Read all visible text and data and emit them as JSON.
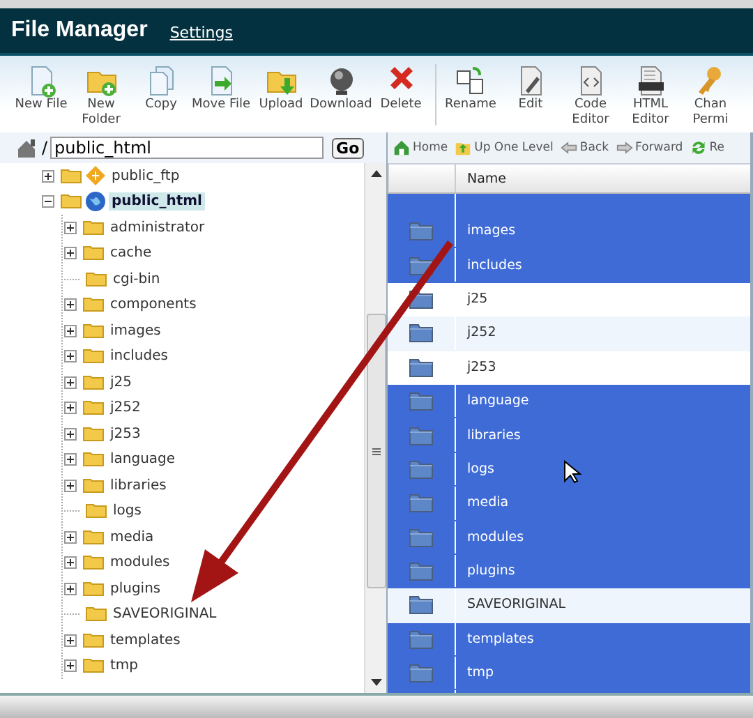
{
  "header": {
    "title": "File Manager",
    "link": "Settings"
  },
  "toolbar": [
    {
      "kind": "new-file",
      "label": "New File"
    },
    {
      "kind": "new-folder",
      "label": "New\nFolder"
    },
    {
      "kind": "copy",
      "label": "Copy"
    },
    {
      "kind": "move",
      "label": "Move File"
    },
    {
      "kind": "upload",
      "label": "Upload"
    },
    {
      "kind": "download",
      "label": "Download"
    },
    {
      "kind": "delete",
      "label": "Delete"
    },
    {
      "kind": "separator"
    },
    {
      "kind": "rename",
      "label": "Rename"
    },
    {
      "kind": "edit",
      "label": "Edit"
    },
    {
      "kind": "code",
      "label": "Code\nEditor"
    },
    {
      "kind": "html",
      "label": "HTML\nEditor"
    },
    {
      "kind": "keys",
      "label": "Chan\nPermi"
    }
  ],
  "path": {
    "prefix": "/",
    "value": "public_html",
    "button": "Go"
  },
  "tree": [
    {
      "label": "public_ftp",
      "kind": "ftp",
      "expanded": false,
      "selected": false
    },
    {
      "label": "public_html",
      "kind": "web",
      "expanded": true,
      "selected": true,
      "children": [
        {
          "label": "administrator",
          "expanded": false,
          "selected": false
        },
        {
          "label": "cache",
          "expanded": false,
          "selected": false
        },
        {
          "label": "cgi-bin",
          "selected": false
        },
        {
          "label": "components",
          "expanded": false,
          "selected": false
        },
        {
          "label": "images",
          "expanded": false,
          "selected": false
        },
        {
          "label": "includes",
          "expanded": false,
          "selected": false
        },
        {
          "label": "j25",
          "expanded": false,
          "selected": false
        },
        {
          "label": "j252",
          "expanded": false,
          "selected": false
        },
        {
          "label": "j253",
          "expanded": false,
          "selected": false
        },
        {
          "label": "language",
          "expanded": false,
          "selected": false
        },
        {
          "label": "libraries",
          "expanded": false,
          "selected": false
        },
        {
          "label": "logs",
          "selected": false
        },
        {
          "label": "media",
          "expanded": false,
          "selected": false
        },
        {
          "label": "modules",
          "expanded": false,
          "selected": false
        },
        {
          "label": "plugins",
          "expanded": false,
          "selected": false
        },
        {
          "label": "SAVEORIGINAL",
          "selected": false
        },
        {
          "label": "templates",
          "expanded": false,
          "selected": false
        },
        {
          "label": "tmp",
          "expanded": false,
          "selected": false
        }
      ]
    }
  ],
  "nav": [
    {
      "kind": "home",
      "label": "Home"
    },
    {
      "kind": "up",
      "label": "Up One Level"
    },
    {
      "kind": "back",
      "label": "Back"
    },
    {
      "kind": "forward",
      "label": "Forward"
    },
    {
      "kind": "reload",
      "label": "Re"
    }
  ],
  "table": {
    "columns": [
      "Name"
    ],
    "rows": [
      {
        "name": "images",
        "selected": true
      },
      {
        "name": "includes",
        "selected": true
      },
      {
        "name": "j25",
        "selected": false
      },
      {
        "name": "j252",
        "selected": false
      },
      {
        "name": "j253",
        "selected": false
      },
      {
        "name": "language",
        "selected": true
      },
      {
        "name": "libraries",
        "selected": true
      },
      {
        "name": "logs",
        "selected": true
      },
      {
        "name": "media",
        "selected": true
      },
      {
        "name": "modules",
        "selected": true
      },
      {
        "name": "plugins",
        "selected": true
      },
      {
        "name": "SAVEORIGINAL",
        "selected": false
      },
      {
        "name": "templates",
        "selected": true
      },
      {
        "name": "tmp",
        "selected": true
      }
    ]
  }
}
